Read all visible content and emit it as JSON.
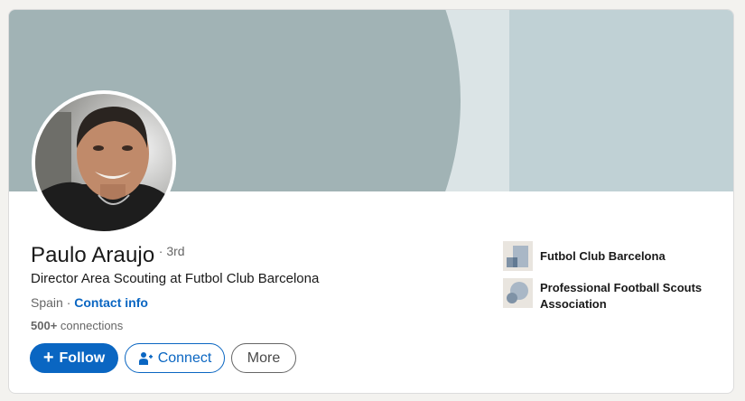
{
  "profile": {
    "name": "Paulo Araujo",
    "degree": "· 3rd",
    "headline": "Director Area Scouting at Futbol Club Barcelona",
    "location": "Spain",
    "location_sep": " · ",
    "contact_label": "Contact info",
    "connections_count": "500+",
    "connections_suffix": " connections"
  },
  "actions": {
    "follow": "Follow",
    "connect": "Connect",
    "more": "More"
  },
  "organizations": [
    {
      "name": "Futbol Club Barcelona",
      "icon": "company-logo"
    },
    {
      "name": "Professional Football Scouts Association",
      "icon": "school-logo"
    }
  ],
  "colors": {
    "accent": "#0a66c2",
    "banner_light": "#c0d1d5",
    "banner_dark": "#a1b3b5"
  }
}
